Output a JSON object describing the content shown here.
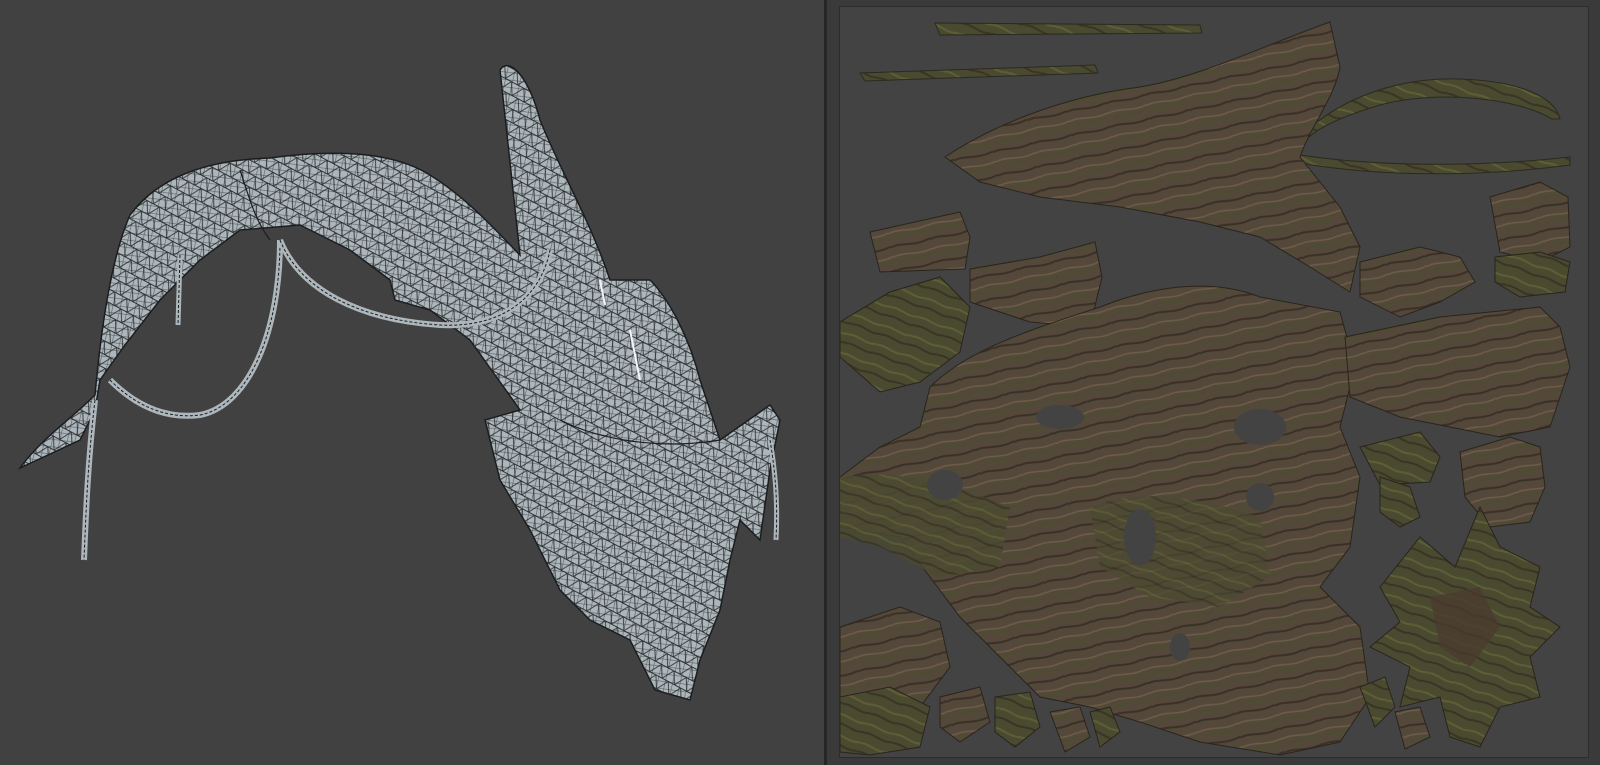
{
  "viewport_3d": {
    "mode": "wireframe-on-shaded",
    "object": "tree-root-branch",
    "background": "#414141",
    "mesh_color": "#aeb8bd",
    "wire_color": "#1a1d20"
  },
  "uv_editor": {
    "texture": "bark-atlas",
    "canvas_background": "#434343",
    "bark_colors": [
      "#4f4033",
      "#5a4a3a",
      "#3f3a2a",
      "#54552f",
      "#6a5846"
    ]
  }
}
